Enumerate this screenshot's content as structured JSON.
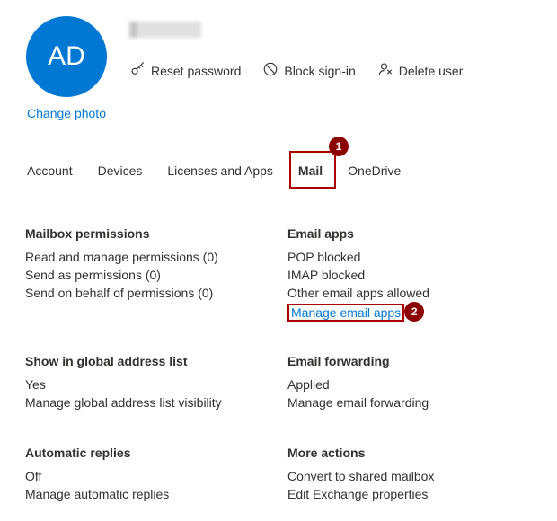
{
  "header": {
    "avatar_initials": "AD",
    "change_photo": "Change photo",
    "actions": {
      "reset_password": "Reset password",
      "block_signin": "Block sign-in",
      "delete_user": "Delete user"
    }
  },
  "tabs": {
    "account": "Account",
    "devices": "Devices",
    "licenses": "Licenses and Apps",
    "mail": "Mail",
    "onedrive": "OneDrive"
  },
  "callouts": {
    "tab_mail": "1",
    "manage_email_apps": "2"
  },
  "sections": {
    "mailbox_permissions": {
      "title": "Mailbox permissions",
      "read_manage": "Read and manage permissions (0)",
      "send_as": "Send as permissions (0)",
      "send_behalf": "Send on behalf of permissions (0)"
    },
    "email_apps": {
      "title": "Email apps",
      "pop": "POP blocked",
      "imap": "IMAP blocked",
      "other": "Other email apps allowed",
      "manage": "Manage email apps"
    },
    "gal": {
      "title": "Show in global address list",
      "value": "Yes",
      "manage": "Manage global address list visibility"
    },
    "forwarding": {
      "title": "Email forwarding",
      "value": "Applied",
      "manage": "Manage email forwarding"
    },
    "auto_replies": {
      "title": "Automatic replies",
      "value": "Off",
      "manage": "Manage automatic replies"
    },
    "more_actions": {
      "title": "More actions",
      "convert": "Convert to shared mailbox",
      "edit_exchange": "Edit Exchange properties"
    }
  }
}
